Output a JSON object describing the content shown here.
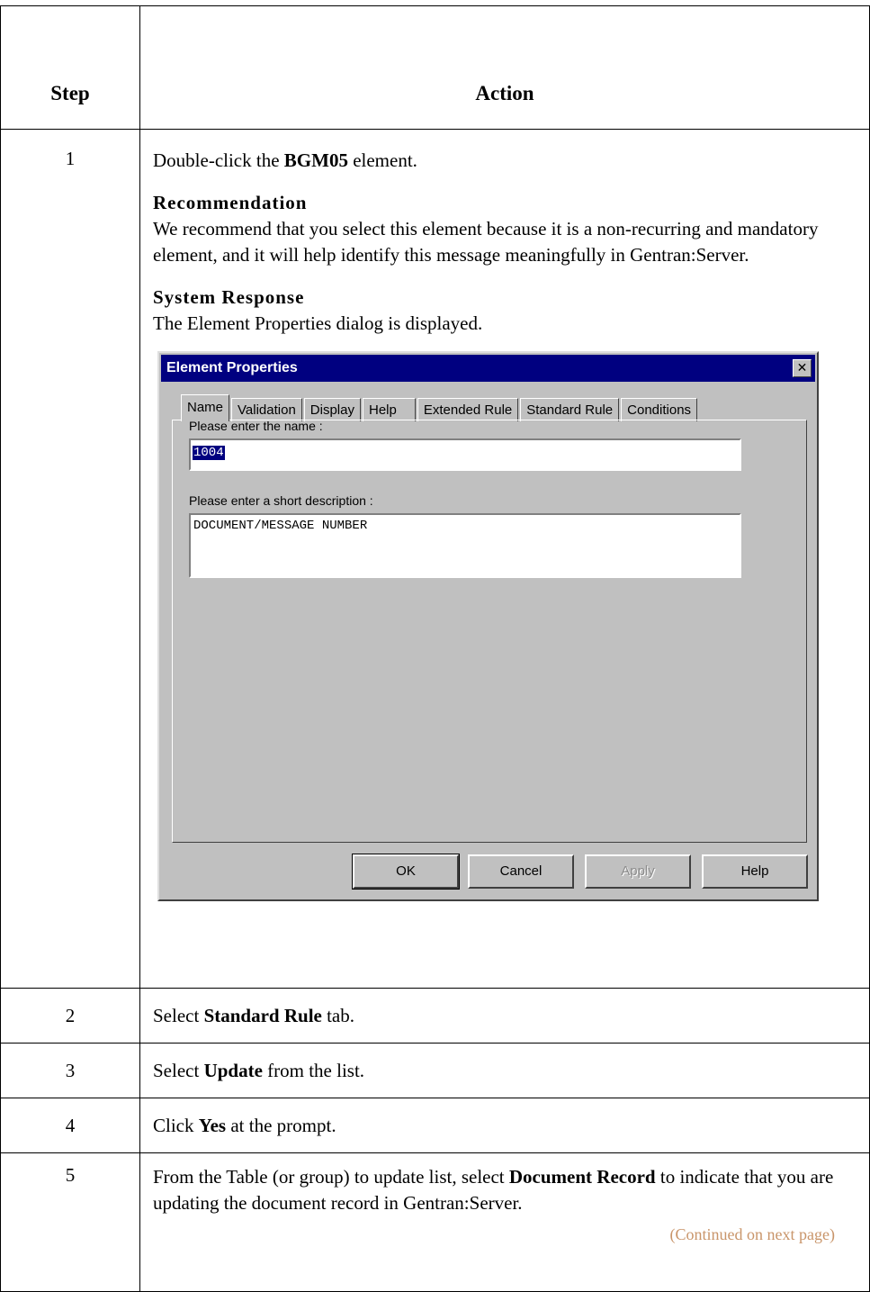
{
  "table": {
    "header_step": "Step",
    "header_action": "Action"
  },
  "step1": {
    "number": "1",
    "pre": "Double-click the ",
    "bold": "BGM05",
    "post": " element.",
    "recommendation_heading": "Recommendation",
    "recommendation_text": "We recommend that you select this element because it is a non-recurring and mandatory element, and it will help identify this message meaningfully in Gentran:Server.",
    "system_response_heading": "System Response",
    "system_response_text": "The Element Properties dialog is displayed."
  },
  "dialog": {
    "title": "Element Properties",
    "close_glyph": "✕",
    "tabs": [
      "Name",
      "Validation",
      "Display",
      "Help",
      "Extended Rule",
      "Standard Rule",
      "Conditions"
    ],
    "name_label": "Please enter the name :",
    "name_value": "1004",
    "desc_label": "Please enter a short description :",
    "desc_value": "DOCUMENT/MESSAGE NUMBER",
    "buttons": {
      "ok": "OK",
      "cancel": "Cancel",
      "apply": "Apply",
      "help": "Help"
    }
  },
  "step2": {
    "number": "2",
    "pre": "Select ",
    "bold": "Standard Rule",
    "post": " tab."
  },
  "step3": {
    "number": "3",
    "pre": "Select ",
    "bold": "Update",
    "post": " from the list."
  },
  "step4": {
    "number": "4",
    "pre": "Click ",
    "bold": "Yes",
    "post": " at the prompt."
  },
  "step5": {
    "number": "5",
    "pre": "From the Table (or group) to update list, select ",
    "bold": "Document Record",
    "post": " to indicate that you are updating the document record in Gentran:Server.",
    "continued": "(Continued on next page)"
  },
  "colors": {
    "continued": "#c9956a",
    "title_bar": "#000080",
    "dialog_face": "#c0c0c0"
  }
}
